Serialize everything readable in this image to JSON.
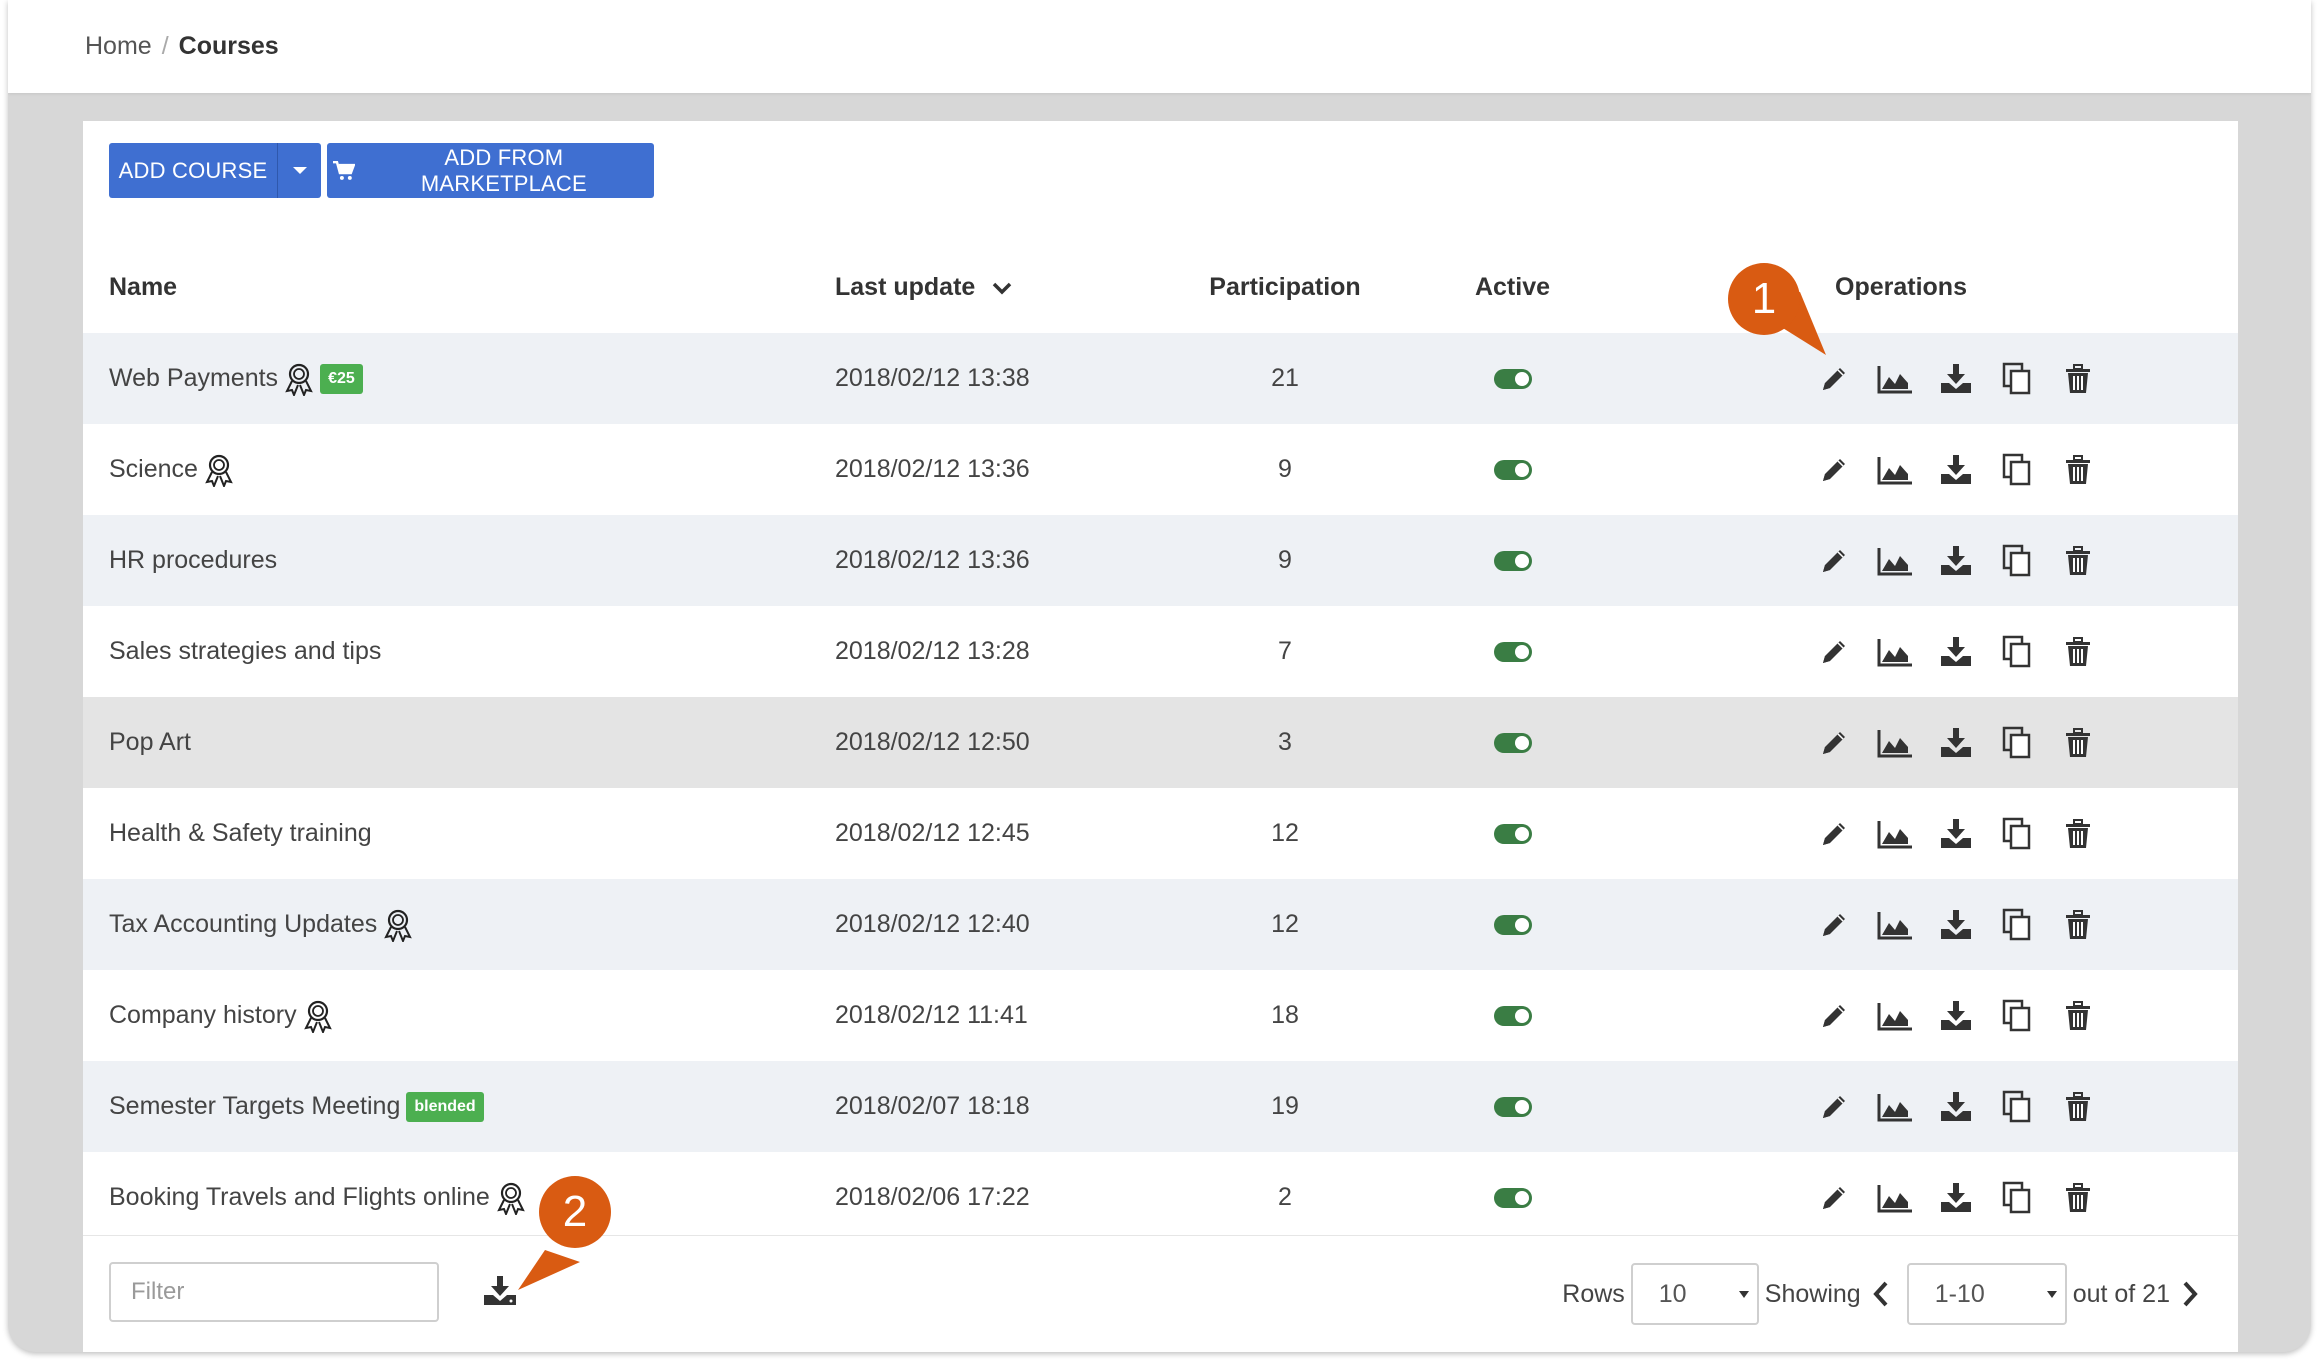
{
  "breadcrumb": {
    "home": "Home",
    "separator": "/",
    "current": "Courses"
  },
  "toolbar": {
    "add_course": "ADD COURSE",
    "add_from_marketplace": "ADD FROM MARKETPLACE",
    "primary_color": "#3f6fd1"
  },
  "table": {
    "headers": {
      "name": "Name",
      "last_update": "Last update",
      "participation": "Participation",
      "active": "Active",
      "operations": "Operations"
    },
    "sort": {
      "column": "Last update",
      "direction": "descending"
    },
    "rows": [
      {
        "name": "Web Payments",
        "certificate": true,
        "badge": "€25",
        "last_update": "2018/02/12 13:38",
        "participation": "21",
        "active": true
      },
      {
        "name": "Science",
        "certificate": true,
        "badge": "",
        "last_update": "2018/02/12 13:36",
        "participation": "9",
        "active": true
      },
      {
        "name": "HR procedures",
        "certificate": false,
        "badge": "",
        "last_update": "2018/02/12 13:36",
        "participation": "9",
        "active": true
      },
      {
        "name": "Sales strategies and tips",
        "certificate": false,
        "badge": "",
        "last_update": "2018/02/12 13:28",
        "participation": "7",
        "active": true
      },
      {
        "name": "Pop Art",
        "certificate": false,
        "badge": "",
        "last_update": "2018/02/12 12:50",
        "participation": "3",
        "active": true
      },
      {
        "name": "Health & Safety training",
        "certificate": false,
        "badge": "",
        "last_update": "2018/02/12 12:45",
        "participation": "12",
        "active": true
      },
      {
        "name": "Tax Accounting Updates",
        "certificate": true,
        "badge": "",
        "last_update": "2018/02/12 12:40",
        "participation": "12",
        "active": true
      },
      {
        "name": "Company history",
        "certificate": true,
        "badge": "",
        "last_update": "2018/02/12 11:41",
        "participation": "18",
        "active": true
      },
      {
        "name": "Semester Targets Meeting",
        "certificate": false,
        "badge": "blended",
        "last_update": "2018/02/07 18:18",
        "participation": "19",
        "active": true
      },
      {
        "name": "Booking Travels and Flights online",
        "certificate": true,
        "badge": "",
        "last_update": "2018/02/06 17:22",
        "participation": "2",
        "active": true
      }
    ],
    "operation_icons": [
      "pencil-icon",
      "area-chart-icon",
      "download-icon",
      "copy-icon",
      "trash-icon"
    ]
  },
  "footer": {
    "filter_placeholder": "Filter",
    "rows_label": "Rows",
    "rows_value": "10",
    "showing_label": "Showing",
    "range_value": "1-10",
    "out_of_label": "out of 21"
  },
  "callouts": [
    "1",
    "2"
  ],
  "colors": {
    "toggle_on": "#3a7d44",
    "badge_green": "#4caf50",
    "callout": "#d95b12"
  }
}
